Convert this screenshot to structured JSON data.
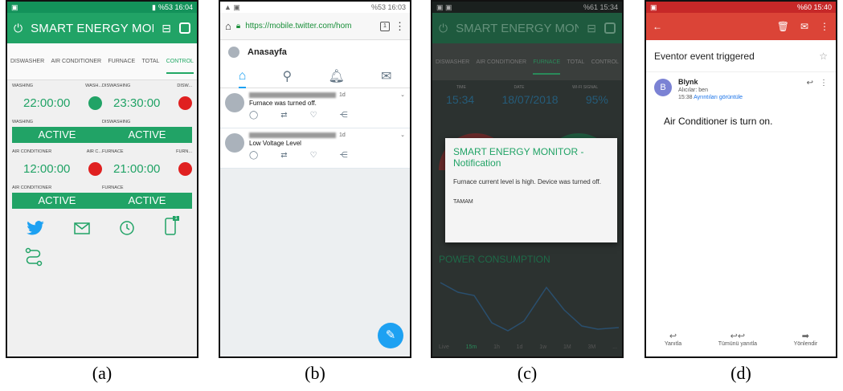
{
  "captions": [
    "(a)",
    "(b)",
    "(c)",
    "(d)"
  ],
  "panel_a": {
    "status_right": "%53 16:04",
    "title": "SMART ENERGY MONI",
    "tabs": [
      "DISWASHER",
      "AIR CONDITIONER",
      "FURNACE",
      "TOTAL",
      "CONTROL"
    ],
    "timers": [
      {
        "label": "WASHING",
        "short": "WASH...",
        "time": "22:00:00",
        "dot": "#21a366"
      },
      {
        "label": "DISWASHING",
        "short": "DISW...",
        "time": "23:30:00",
        "dot": "#e02020"
      },
      {
        "label": "AIR CONDITIONER",
        "short": "AIR C...",
        "time": "12:00:00",
        "dot": "#e02020"
      },
      {
        "label": "FURNACE",
        "short": "FURN...",
        "time": "21:00:00",
        "dot": "#e02020"
      }
    ],
    "buttons": [
      {
        "label": "WASHING",
        "text": "ACTIVE"
      },
      {
        "label": "DISWASHING",
        "text": "ACTIVE"
      },
      {
        "label": "AIR CONDITIONER",
        "text": "ACTIVE"
      },
      {
        "label": "FURNACE",
        "text": "ACTIVE"
      }
    ],
    "badge": "1"
  },
  "panel_b": {
    "status_right": "%53 16:03",
    "url": "https://mobile.twitter.com/hom",
    "tab_count": "1",
    "home": "Anasayfa",
    "tweets": [
      {
        "time": "1d",
        "text": "Furnace was turned off."
      },
      {
        "time": "1d",
        "text": "Low Voltage Level"
      }
    ]
  },
  "panel_c": {
    "status_right": "%61 15:34",
    "title": "SMART ENERGY MONI",
    "tabs": [
      "DISWASHER",
      "AIR CONDITIONER",
      "FURNACE",
      "TOTAL",
      "CONTROL"
    ],
    "labels": [
      "TIME",
      "DATE",
      "WI-FI SIGNAL"
    ],
    "values": [
      "15:34",
      "18/07/2018",
      "95%"
    ],
    "dialog_title": "SMART ENERGY MONITOR - Notification",
    "dialog_message": "Furnace current level is high. Device was turned off.",
    "dialog_ok": "TAMAM",
    "power_title": "POWER CONSUMPTION",
    "ranges": [
      "Live",
      "15m",
      "1h",
      "1d",
      "1w",
      "1M",
      "3M",
      "..."
    ]
  },
  "panel_d": {
    "status_right": "%60 15:40",
    "subject": "Eventor event triggered",
    "sender": "Blynk",
    "avatar_letter": "B",
    "recipients": "Alıcılar: ben",
    "time": "15:38",
    "details_link": "Ayrıntıları görüntüle",
    "body": "Air Conditioner is turn on.",
    "actions": [
      "Yanıtla",
      "Tümünü yanıtla",
      "Yönlendir"
    ]
  }
}
